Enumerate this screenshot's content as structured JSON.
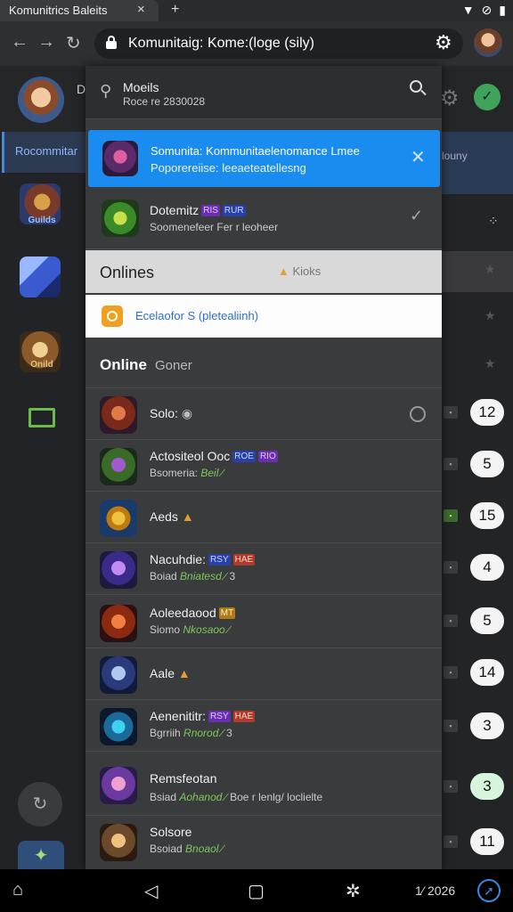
{
  "browser": {
    "tab_title": "Komunitrics Baleits",
    "tab_close": "×",
    "tab_new": "+",
    "url": "Komunitaig: Kome:(loge (sily)",
    "nav_back": "←",
    "nav_forward": "→",
    "nav_reload": "↻",
    "gear": "⚙"
  },
  "status_bar": {
    "wifi": "▼",
    "notif": "⊘",
    "battery": "▮"
  },
  "app": {
    "user_initial": "D",
    "header_gear": "⚙",
    "header_action": "✓",
    "rail": {
      "selected_label": "Rocommitar",
      "caption_1": "Guilds",
      "caption_2": "Onild",
      "clock": "↻",
      "tool": "✦"
    },
    "right": {
      "banner": "louny",
      "dot_menu": "⁘",
      "star": "★",
      "counts": [
        "12",
        "5",
        "15",
        "4",
        "5",
        "14",
        "3",
        "3",
        "11"
      ],
      "sq": "▪"
    }
  },
  "panel": {
    "search": {
      "pin": "⚲",
      "title": "Moeils",
      "subtitle": "Roce re 2830028"
    },
    "notice": {
      "title": "Somunita: Kommunitaelenomance Lmee",
      "subtitle": "Poporereiise: leeaeteatellesng",
      "close": "✕"
    },
    "featured": {
      "name": "Dotemitz",
      "tag1": "RIS",
      "tag2": "RUR",
      "subtitle": "Soomenefeer Fer r leoheer",
      "check": "✓"
    },
    "onlines": {
      "title": "Onlines",
      "warn_glyph": "▲",
      "warn_text": "Kioks"
    },
    "status": {
      "text": "Ecelaofor S (pletealiinh)"
    },
    "section": {
      "title": "Online",
      "subtitle": "Goner"
    },
    "rows": [
      {
        "name": "Solo:",
        "badge": "◉"
      },
      {
        "name": "Actositeol Ooc",
        "tag1": "ROE",
        "tag2": "RIO",
        "sub": "Bsomeria:",
        "sub_green": "Beil ∕"
      },
      {
        "name": "Aeds",
        "badge": "▲"
      },
      {
        "name": "Nacuhdie:",
        "tag1": "RSY",
        "tag2": "HAE",
        "sub": "Boiad",
        "sub_green": "Bniatesd ∕",
        "sub_tail": "3"
      },
      {
        "name": "Aoleedaood",
        "tag1": "MT",
        "sub": "Siomo",
        "sub_green": "Nkosaoo ∕"
      },
      {
        "name": "Aale",
        "badge": "▲"
      },
      {
        "name": "Aenenititr:",
        "tag1": "RSY",
        "tag2": "HAE",
        "sub": "Bgrriih",
        "sub_green": "Rnorod ∕",
        "sub_tail": "3"
      },
      {
        "name": "Remsfeotan",
        "sub": "Bsiad",
        "sub_green": "Aohanod ∕",
        "sub_tail": "Boe r lenlg/ loclielte"
      },
      {
        "name": "Solsore",
        "sub": "Bsoiad",
        "sub_green": "Bnoaol ∕"
      }
    ]
  },
  "system_nav": {
    "home": "⌂",
    "back": "◁",
    "recents": "▢",
    "assist": "✲",
    "time": "1⁄ 2026",
    "compass": "➚"
  },
  "colors": {
    "accent": "#1a8cf0",
    "green": "#7dc85a",
    "panel": "#3a3b3d"
  }
}
